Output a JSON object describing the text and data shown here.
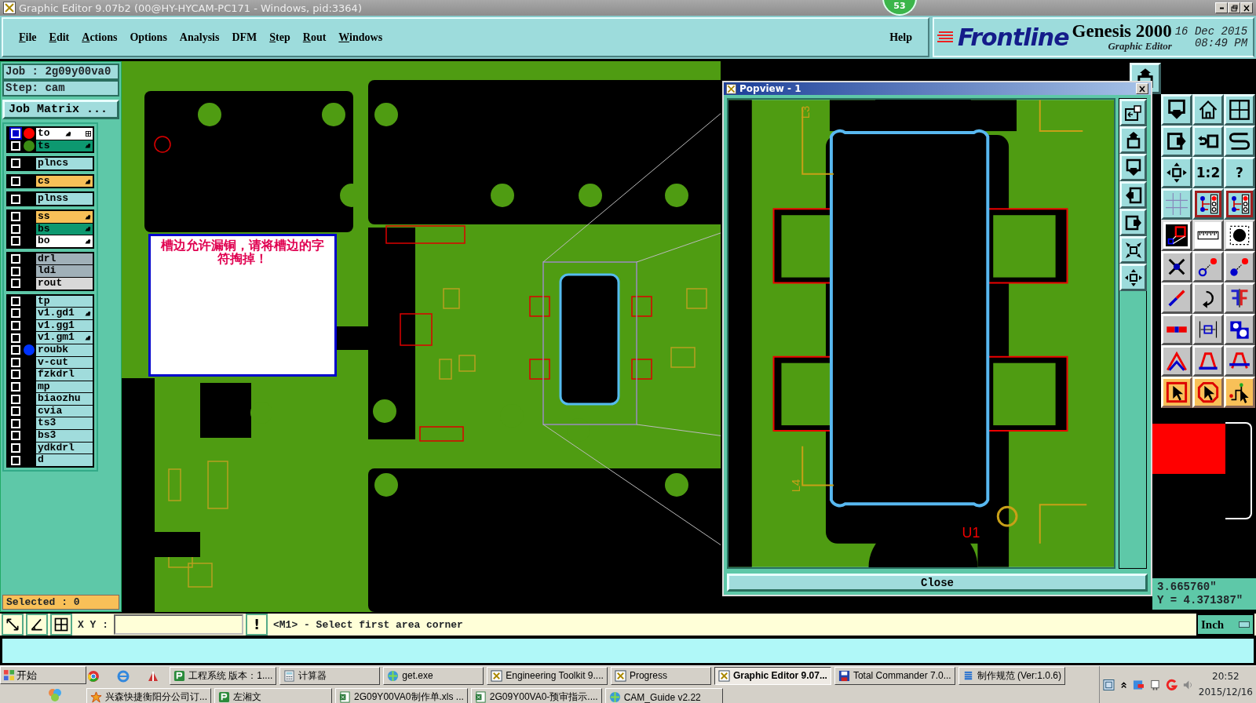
{
  "window": {
    "title": "Graphic Editor 9.07b2 (00@HY-HYCAM-PC171 - Windows, pid:3364)",
    "badge": "53"
  },
  "menu": [
    {
      "label": "File",
      "mnemonic": true
    },
    {
      "label": "Edit",
      "mnemonic": true
    },
    {
      "label": "Actions",
      "mnemonic": true
    },
    {
      "label": "Options",
      "mnemonic": false
    },
    {
      "label": "Analysis",
      "mnemonic": false
    },
    {
      "label": "DFM",
      "mnemonic": false
    },
    {
      "label": "Step",
      "mnemonic": true
    },
    {
      "label": "Rout",
      "mnemonic": true
    },
    {
      "label": "Windows",
      "mnemonic": true
    }
  ],
  "help": "Help",
  "logo": {
    "brand": "Frontline",
    "product": "Genesis 2000",
    "subtitle": "Graphic Editor",
    "date": "16 Dec 2015",
    "time": "08:49 PM"
  },
  "job": {
    "job": "Job : 2g09y00va0",
    "step": "Step: cam",
    "matrix_button": "Job Matrix ..."
  },
  "layer_groups": [
    [
      {
        "name": "to",
        "color": "#ffffff",
        "selected": true,
        "affected": true,
        "grid_icon": true,
        "dot": {
          "color": "#ff0000"
        }
      },
      {
        "name": "ts",
        "color": "#0d9870",
        "selected": false,
        "affected": true,
        "grid_icon": false,
        "dot": {
          "color": "#3c8c14"
        }
      }
    ],
    [
      {
        "name": "plncs",
        "color": "#a0dcdc",
        "selected": false,
        "affected": false,
        "grid_icon": false
      }
    ],
    [
      {
        "name": "cs",
        "color": "#f8c058",
        "selected": false,
        "affected": true,
        "grid_icon": false
      }
    ],
    [
      {
        "name": "plnss",
        "color": "#a0dcdc",
        "selected": false,
        "affected": false,
        "grid_icon": false
      }
    ],
    [
      {
        "name": "ss",
        "color": "#f8c058",
        "selected": false,
        "affected": true,
        "grid_icon": false
      },
      {
        "name": "bs",
        "color": "#0d9870",
        "selected": false,
        "affected": true,
        "grid_icon": false
      },
      {
        "name": "bo",
        "color": "#ffffff",
        "selected": false,
        "affected": true,
        "grid_icon": false
      }
    ],
    [
      {
        "name": "drl",
        "color": "#a0b0b8",
        "selected": false,
        "affected": false,
        "grid_icon": false
      },
      {
        "name": "ldi",
        "color": "#a0b0b8",
        "selected": false,
        "affected": false,
        "grid_icon": false
      },
      {
        "name": "rout",
        "color": "#d8d8d8",
        "selected": false,
        "affected": false,
        "grid_icon": false
      }
    ],
    [
      {
        "name": "tp",
        "color": "#a0dcdc",
        "selected": false,
        "affected": false,
        "grid_icon": false
      },
      {
        "name": "v1.gd1",
        "color": "#a0dcdc",
        "selected": false,
        "affected": true,
        "grid_icon": false
      },
      {
        "name": "v1.gg1",
        "color": "#a0dcdc",
        "selected": false,
        "affected": false,
        "grid_icon": false
      },
      {
        "name": "v1.gm1",
        "color": "#a0dcdc",
        "selected": false,
        "affected": true,
        "grid_icon": false
      },
      {
        "name": "roubk",
        "color": "#a0dcdc",
        "selected": false,
        "affected": false,
        "grid_icon": false,
        "dot": {
          "color": "#0033ff"
        }
      },
      {
        "name": "v-cut",
        "color": "#a0dcdc",
        "selected": false,
        "affected": false,
        "grid_icon": false
      },
      {
        "name": "fzkdrl",
        "color": "#a0dcdc",
        "selected": false,
        "affected": false,
        "grid_icon": false
      },
      {
        "name": "mp",
        "color": "#a0dcdc",
        "selected": false,
        "affected": false,
        "grid_icon": false
      },
      {
        "name": "biaozhu",
        "color": "#a0dcdc",
        "selected": false,
        "affected": false,
        "grid_icon": false
      },
      {
        "name": "cvia",
        "color": "#a0dcdc",
        "selected": false,
        "affected": false,
        "grid_icon": false
      },
      {
        "name": "ts3",
        "color": "#a0dcdc",
        "selected": false,
        "affected": false,
        "grid_icon": false
      },
      {
        "name": "bs3",
        "color": "#a0dcdc",
        "selected": false,
        "affected": false,
        "grid_icon": false
      },
      {
        "name": "ydkdrl",
        "color": "#a0dcdc",
        "selected": false,
        "affected": false,
        "grid_icon": false
      },
      {
        "name": "d",
        "color": "#a0dcdc",
        "selected": false,
        "affected": false,
        "grid_icon": false
      }
    ]
  ],
  "selected_count": "Selected : 0",
  "note": "槽边允许漏铜，请将槽边的字符掏掉！",
  "popview": {
    "title": "Popview - 1",
    "labels": [
      "L3",
      "U1",
      "L4"
    ],
    "close": "Close",
    "tools": [
      {
        "kind": "zoom-box"
      },
      {
        "kind": "box-up"
      },
      {
        "kind": "box-down"
      },
      {
        "kind": "box-left"
      },
      {
        "kind": "box-right"
      },
      {
        "kind": "fit"
      },
      {
        "kind": "move"
      }
    ]
  },
  "tools": {
    "top": {
      "kind": "box-up"
    },
    "rows": [
      [
        {
          "kind": "box-down"
        },
        {
          "kind": "home"
        },
        {
          "kind": "grid-xy"
        }
      ],
      [
        {
          "kind": "box-right"
        },
        {
          "kind": "undo-box"
        },
        {
          "kind": "s-curve"
        }
      ],
      [
        {
          "kind": "move"
        },
        {
          "kind": "text",
          "label": "1:2"
        },
        {
          "kind": "text",
          "label": "?"
        }
      ],
      [
        {
          "kind": "grid"
        },
        {
          "kind": "net"
        },
        {
          "kind": "net"
        }
      ],
      [
        {
          "kind": "layer-diff"
        },
        {
          "kind": "ruler"
        },
        {
          "kind": "pad"
        }
      ],
      [
        {
          "kind": "cross"
        },
        {
          "kind": "pad-outline"
        },
        {
          "kind": "pad-fill"
        }
      ],
      [
        {
          "kind": "line-diag"
        },
        {
          "kind": "rotate"
        },
        {
          "kind": "mirror"
        }
      ],
      [
        {
          "kind": "line-h"
        },
        {
          "kind": "measure"
        },
        {
          "kind": "shapes"
        }
      ],
      [
        {
          "kind": "arc-red"
        },
        {
          "kind": "arc-blue"
        },
        {
          "kind": "arc-both"
        }
      ],
      [
        {
          "kind": "select-rect"
        },
        {
          "kind": "select-oct"
        },
        {
          "kind": "select-route"
        }
      ]
    ]
  },
  "coords": {
    "x": "3.665760\"",
    "y": "Y = 4.371387\""
  },
  "status": {
    "xy_label": "X Y :",
    "alert": "!",
    "message": "<M1> - Select first area corner",
    "units": "Inch"
  },
  "taskbar": {
    "start": "开始",
    "row1": [
      {
        "label": "工程系统  版本：1....",
        "kind": "app",
        "selected": false
      },
      {
        "label": "计算器",
        "kind": "calculator",
        "selected": false
      },
      {
        "label": "get.exe",
        "kind": "globe",
        "selected": false
      },
      {
        "label": "Engineering Toolkit 9....",
        "kind": "editor",
        "selected": false
      },
      {
        "label": "Progress",
        "kind": "editor",
        "selected": false
      },
      {
        "label": "Graphic Editor 9.07...",
        "kind": "editor",
        "selected": true
      },
      {
        "label": "Total Commander 7.0...",
        "kind": "floppy",
        "selected": false
      },
      {
        "label": "制作规范 (Ver:1.0.6)",
        "kind": "doc",
        "selected": false
      }
    ],
    "row2": [
      {
        "label": "兴森快捷衡阳分公司订...",
        "kind": "star",
        "selected": false
      },
      {
        "label": "左湘文",
        "kind": "app",
        "selected": false
      },
      {
        "label": "2G09Y00VA0制作单.xls ...",
        "kind": "sheet",
        "selected": false
      },
      {
        "label": "2G09Y00VA0-预审指示....",
        "kind": "sheet",
        "selected": false
      },
      {
        "label": "CAM_Guide v2.22",
        "kind": "globe",
        "selected": false
      }
    ],
    "clock": {
      "time": "20:52",
      "date": "2015/12/16"
    }
  }
}
